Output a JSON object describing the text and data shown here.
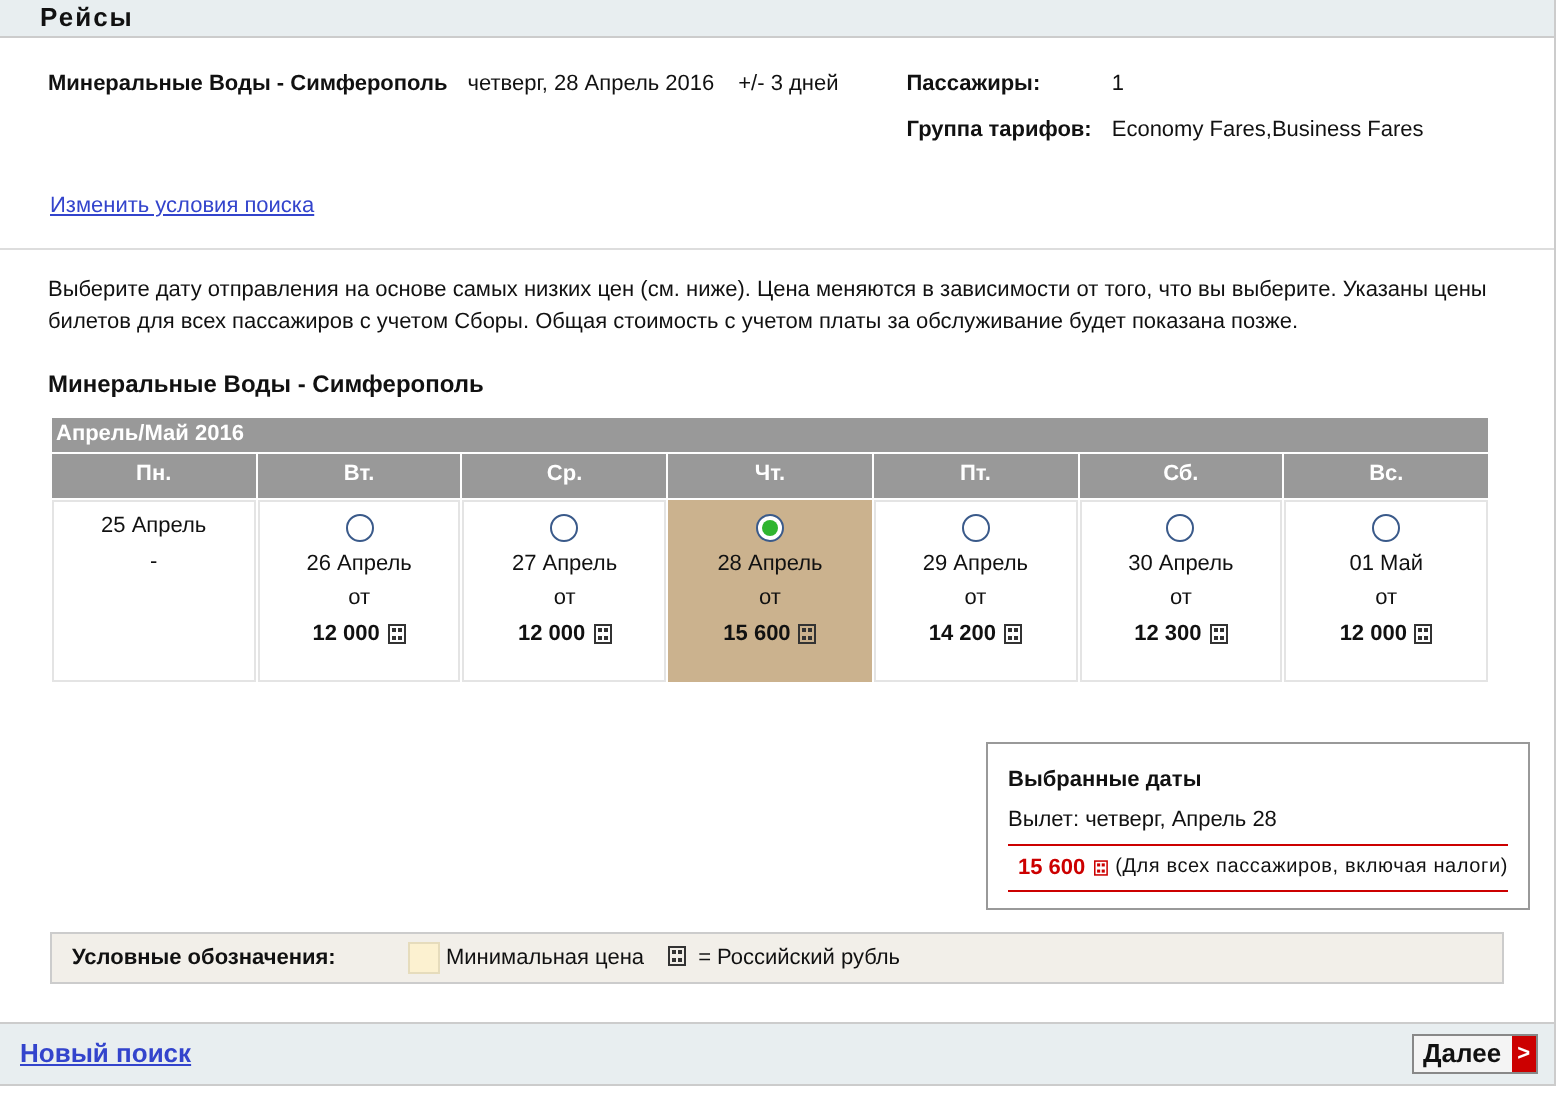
{
  "header": {
    "title": "Рейсы"
  },
  "search": {
    "route": "Минеральные Воды - Симферополь",
    "date": "четверг, 28 Апрель 2016",
    "range": "+/- 3 дней",
    "passengers_label": "Пассажиры:",
    "passengers": "1",
    "fare_group_label": "Группа тарифов:",
    "fare_group": "Economy Fares,Business Fares",
    "modify_link": "Изменить условия поиска"
  },
  "intro": "Выберите дату отправления на основе самых низких цен (см. ниже). Цена меняются в зависимости от того, что вы выберите. Указаны цены билетов для всех пассажиров с учетом Сборы. Общая стоимость с учетом платы за обслуживание будет показана позже.",
  "route_title": "Минеральные Воды - Симферополь",
  "calendar": {
    "month": "Апрель/Май 2016",
    "weekdays": [
      "Пн.",
      "Вт.",
      "Ср.",
      "Чт.",
      "Пт.",
      "Сб.",
      "Вс."
    ],
    "days": [
      {
        "kind": "empty",
        "date": "25 Апрель",
        "price": "-"
      },
      {
        "kind": "fare",
        "date": "26 Апрель",
        "from": "от",
        "price": "12 000",
        "selected": false
      },
      {
        "kind": "fare",
        "date": "27 Апрель",
        "from": "от",
        "price": "12 000",
        "selected": false
      },
      {
        "kind": "fare",
        "date": "28 Апрель",
        "from": "от",
        "price": "15 600",
        "selected": true
      },
      {
        "kind": "fare",
        "date": "29 Апрель",
        "from": "от",
        "price": "14 200",
        "selected": false
      },
      {
        "kind": "fare",
        "date": "30 Апрель",
        "from": "от",
        "price": "12 300",
        "selected": false
      },
      {
        "kind": "fare",
        "date": "01 Май",
        "from": "от",
        "price": "12 000",
        "selected": false
      }
    ]
  },
  "selected_dates": {
    "title": "Выбранные даты",
    "departure": "Вылет: четверг, Апрель 28",
    "price": "15 600",
    "note": "(Для всех пассажиров, включая налоги)"
  },
  "legend": {
    "label": "Условные обозначения:",
    "min_price": "Минимальная цена",
    "currency": "= Российский рубль"
  },
  "footer": {
    "new_search": "Новый поиск",
    "next": "Далее",
    "next_arrow": ">"
  }
}
